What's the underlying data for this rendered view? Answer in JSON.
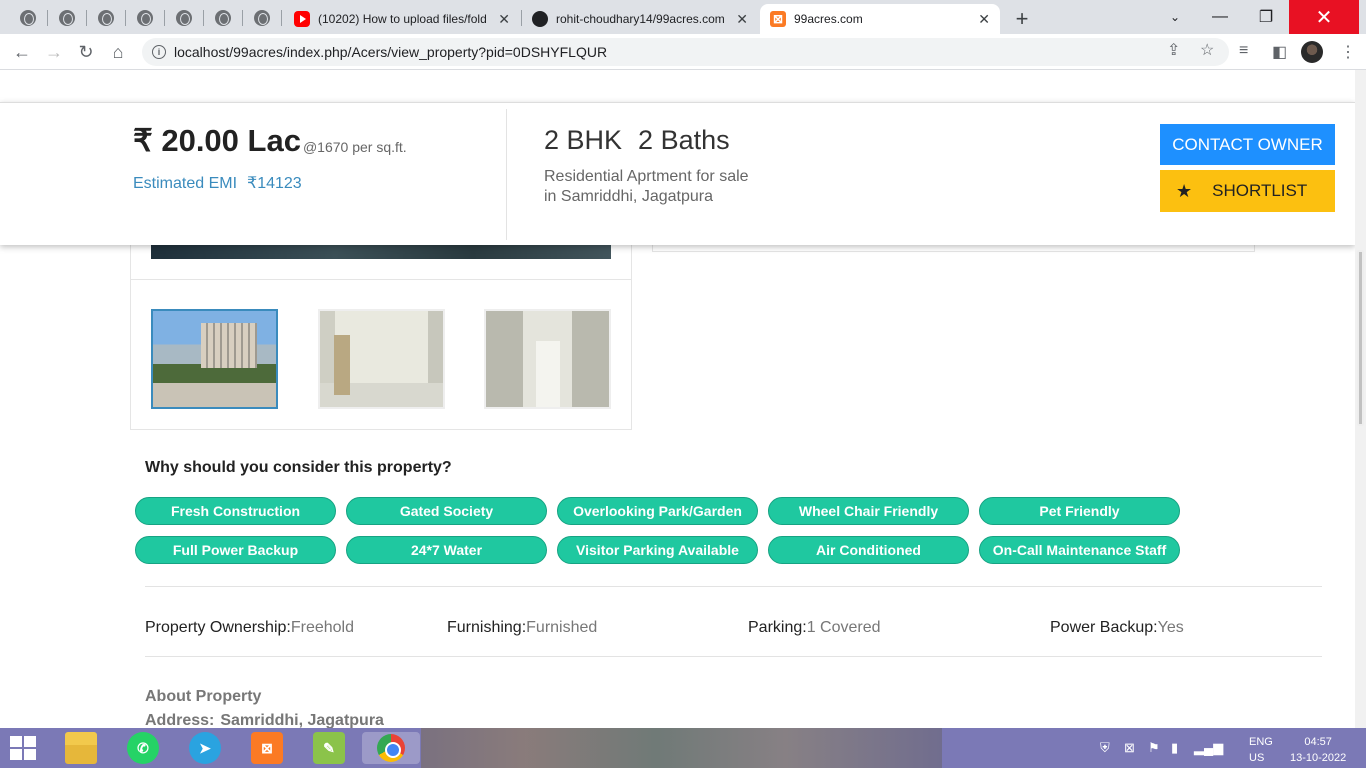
{
  "browser": {
    "tabs": [
      {
        "title": "(10202) How to upload files/fold",
        "icon": "youtube-icon"
      },
      {
        "title": "rohit-choudhary14/99acres.com",
        "icon": "github-icon"
      },
      {
        "title": "99acres.com",
        "icon": "xampp-icon",
        "active": true
      }
    ],
    "close_glyph": "✕",
    "new_tab": "+",
    "url": "localhost/99acres/index.php/Acers/view_property?pid=0DSHYFLQUR"
  },
  "summary": {
    "price": "₹ 20.00 Lac",
    "rate": "@1670 per sq.ft.",
    "emi_label": "Estimated EMI",
    "emi_value": "₹14123",
    "bhk": "2 BHK",
    "baths": "2 Baths",
    "type_line1": "Residential Aprtment for sale",
    "type_line2": "in Samriddhi, Jagatpura",
    "contact_label": "CONTACT OWNER",
    "shortlist_label": "SHORTLIST"
  },
  "features": {
    "title": "Why should you consider this property?",
    "items": [
      "Fresh Construction",
      "Gated Society",
      "Overlooking Park/Garden",
      "Wheel Chair Friendly",
      "Pet Friendly",
      "Full Power Backup",
      "24*7 Water",
      "Visitor Parking Available",
      "Air Conditioned",
      "On-Call Maintenance Staff"
    ],
    "color": "#1fc8a0"
  },
  "attributes": [
    {
      "label": "Property Ownership:",
      "value": "Freehold"
    },
    {
      "label": "Furnishing:",
      "value": "Furnished"
    },
    {
      "label": "Parking:",
      "value": "1 Covered"
    },
    {
      "label": "Power Backup:",
      "value": "Yes"
    }
  ],
  "about": {
    "title": "About Property",
    "address_label": "Address:",
    "address_value": "Samriddhi, Jagatpura"
  },
  "taskbar": {
    "lang1": "ENG",
    "lang2": "US",
    "time": "04:57",
    "date": "13-10-2022"
  },
  "colors": {
    "contact": "#1e90ff",
    "shortlist": "#fcc010",
    "emi": "#3a8bbd"
  }
}
